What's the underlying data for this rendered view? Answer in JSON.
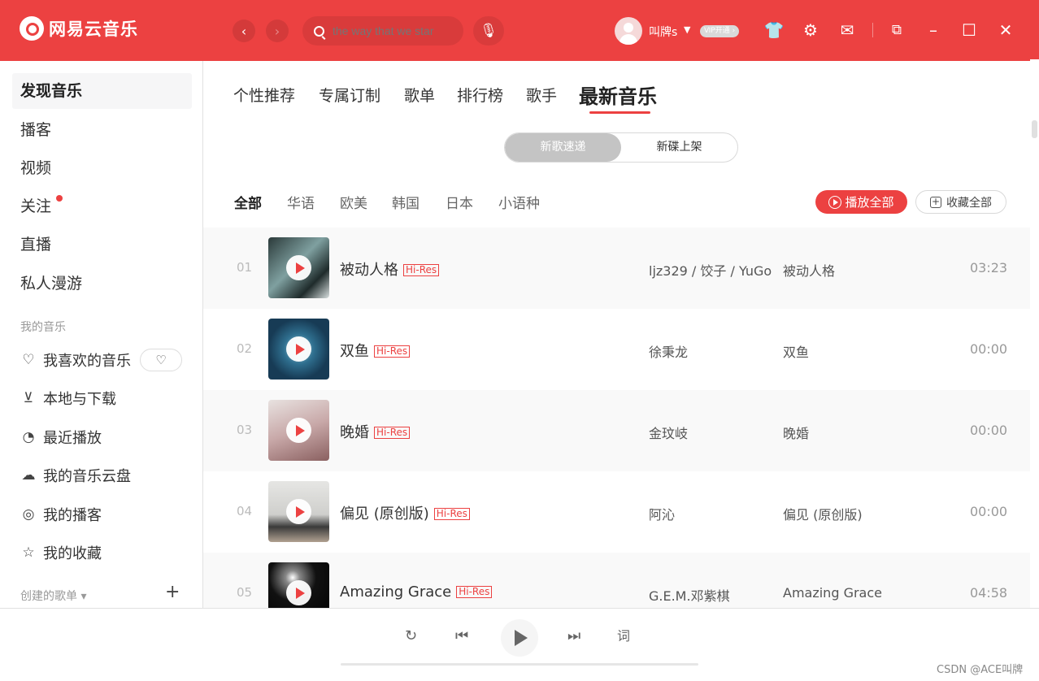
{
  "app": {
    "name": "网易云音乐",
    "accent": "#ec4141"
  },
  "topbar": {
    "search_placeholder": "the way that we star",
    "username": "叫牌s",
    "vip_label": "ⅥP开通 ›",
    "icons": [
      "back-arrow-icon",
      "forward-arrow-icon",
      "search-icon",
      "microphone-icon",
      "skin-tshirt-icon",
      "settings-gear-icon",
      "mail-icon",
      "mini-mode-icon",
      "minimize-icon",
      "maximize-icon",
      "close-icon"
    ]
  },
  "sidebar": {
    "items": [
      {
        "label": "发现音乐",
        "active": true
      },
      {
        "label": "播客"
      },
      {
        "label": "视频"
      },
      {
        "label": "关注",
        "badge": true
      },
      {
        "label": "直播"
      },
      {
        "label": "私人漫游"
      }
    ],
    "my_music_title": "我的音乐",
    "my_music": [
      {
        "label": "我喜欢的音乐",
        "icon": "heart-icon"
      },
      {
        "label": "本地与下载",
        "icon": "download-icon"
      },
      {
        "label": "最近播放",
        "icon": "clock-icon"
      },
      {
        "label": "我的音乐云盘",
        "icon": "cloud-icon"
      },
      {
        "label": "我的播客",
        "icon": "podcast-icon"
      },
      {
        "label": "我的收藏",
        "icon": "user-star-icon"
      }
    ],
    "created_playlists_title": "创建的歌单 ▾"
  },
  "tabs": [
    "个性推荐",
    "专属订制",
    "歌单",
    "排行榜",
    "歌手",
    "最新音乐"
  ],
  "active_tab": "最新音乐",
  "segment": {
    "options": [
      "新歌速递",
      "新碟上架"
    ],
    "selected": "新歌速递"
  },
  "languages": [
    "全部",
    "华语",
    "欧美",
    "韩国",
    "日本",
    "小语种"
  ],
  "selected_language": "全部",
  "actions": {
    "play_all": "播放全部",
    "collect_all": "收藏全部"
  },
  "songs": [
    {
      "no": "01",
      "title": "被动人格",
      "tag": "Hi-Res",
      "artist": "ljz329 / 饺子 / YuGo",
      "album": "被动人格",
      "duration": "03:23"
    },
    {
      "no": "02",
      "title": "双鱼",
      "tag": "Hi-Res",
      "artist": "徐秉龙",
      "album": "双鱼",
      "duration": "00:00"
    },
    {
      "no": "03",
      "title": "晚婚",
      "tag": "Hi-Res",
      "artist": "金玟岐",
      "album": "晚婚",
      "duration": "00:00"
    },
    {
      "no": "04",
      "title": "偏见 (原创版)",
      "tag": "Hi-Res",
      "artist": "阿沁",
      "album": "偏见 (原创版)",
      "duration": "00:00"
    },
    {
      "no": "05",
      "title": "Amazing Grace",
      "tag": "Hi-Res",
      "artist": "G.E.M.邓紫棋",
      "album": "Amazing Grace",
      "duration": "04:58"
    }
  ],
  "player": {
    "lyrics_label": "词"
  },
  "watermark": "CSDN @ACE叫牌"
}
